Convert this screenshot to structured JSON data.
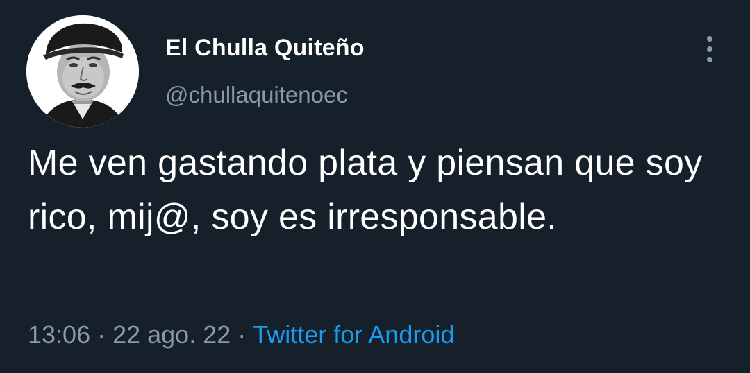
{
  "tweet": {
    "author": {
      "display_name": "El Chulla Quiteño",
      "handle": "@chullaquitenoec",
      "avatar": "avatar-portrait"
    },
    "text": "Me ven gastando plata y piensan que soy rico, mij@, soy es irresponsable.",
    "time": "13:06",
    "separator": "·",
    "date": "22 ago. 22",
    "source": "Twitter for Android",
    "more_icon": "more-vertical-icon"
  },
  "colors": {
    "background": "#15202b",
    "primary_text": "#ffffff",
    "secondary_text": "#8b98a5",
    "link": "#1d9bf0"
  }
}
